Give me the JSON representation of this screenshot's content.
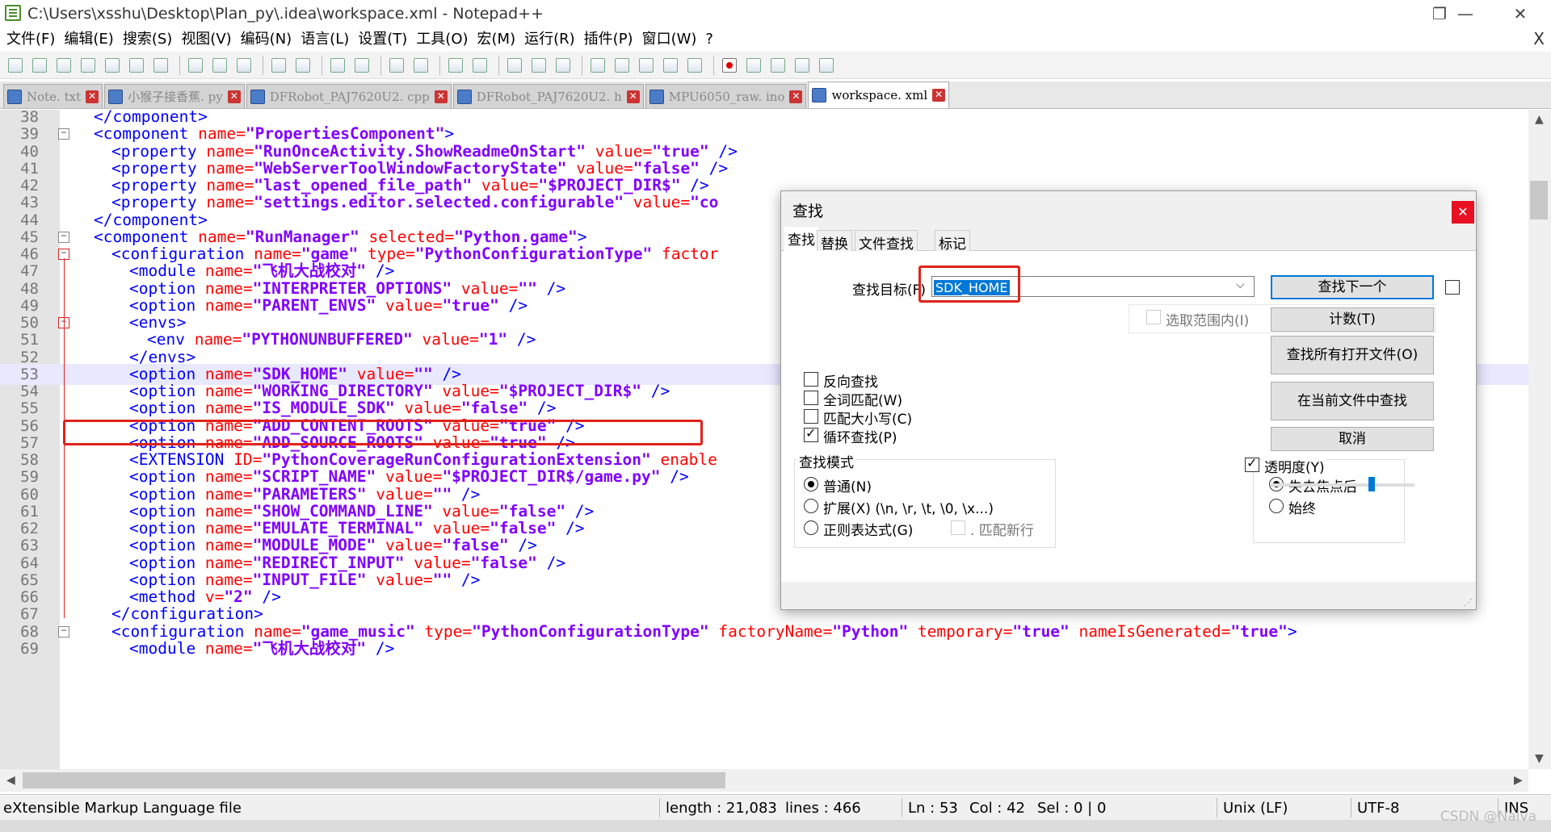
{
  "window": {
    "title": "C:\\Users\\xsshu\\Desktop\\Plan_py\\.idea\\workspace.xml - Notepad++",
    "minimize_glyph": "—",
    "maximize_glyph": "❐",
    "close_glyph": "✕"
  },
  "menubar": {
    "items": [
      "文件(F)",
      "编辑(E)",
      "搜索(S)",
      "视图(V)",
      "编码(N)",
      "语言(L)",
      "设置(T)",
      "工具(O)",
      "宏(M)",
      "运行(R)",
      "插件(P)",
      "窗口(W)",
      "?"
    ],
    "close_glyph": "X"
  },
  "tabs": [
    {
      "label": "Note. txt",
      "active": false
    },
    {
      "label": "小猴子接香蕉. py",
      "active": false
    },
    {
      "label": "DFRobot_PAJ7620U2. cpp",
      "active": false
    },
    {
      "label": "DFRobot_PAJ7620U2. h",
      "active": false
    },
    {
      "label": "MPU6050_raw. ino",
      "active": false
    },
    {
      "label": "workspace. xml",
      "active": true
    }
  ],
  "tab_close_glyph": "✕",
  "editor": {
    "current_line": 53,
    "lines": [
      {
        "n": "38",
        "indent": 1,
        "parts": [
          [
            "t",
            "</component>"
          ]
        ]
      },
      {
        "n": "39",
        "indent": 1,
        "parts": [
          [
            "t",
            "<component "
          ],
          [
            "a",
            "name="
          ],
          [
            "v",
            "\"PropertiesComponent\""
          ],
          [
            "t",
            ">"
          ]
        ]
      },
      {
        "n": "40",
        "indent": 2,
        "parts": [
          [
            "t",
            "<property "
          ],
          [
            "a",
            "name="
          ],
          [
            "v",
            "\"RunOnceActivity.ShowReadmeOnStart\""
          ],
          [
            "a",
            " value="
          ],
          [
            "v",
            "\"true\""
          ],
          [
            "t",
            " />"
          ]
        ]
      },
      {
        "n": "41",
        "indent": 2,
        "parts": [
          [
            "t",
            "<property "
          ],
          [
            "a",
            "name="
          ],
          [
            "v",
            "\"WebServerToolWindowFactoryState\""
          ],
          [
            "a",
            " value="
          ],
          [
            "v",
            "\"false\""
          ],
          [
            "t",
            " />"
          ]
        ]
      },
      {
        "n": "42",
        "indent": 2,
        "parts": [
          [
            "t",
            "<property "
          ],
          [
            "a",
            "name="
          ],
          [
            "v",
            "\"last_opened_file_path\""
          ],
          [
            "a",
            " value="
          ],
          [
            "v",
            "\"$PROJECT_DIR$\""
          ],
          [
            "t",
            " />"
          ]
        ]
      },
      {
        "n": "43",
        "indent": 2,
        "parts": [
          [
            "t",
            "<property "
          ],
          [
            "a",
            "name="
          ],
          [
            "v",
            "\"settings.editor.selected.configurable\""
          ],
          [
            "a",
            " value="
          ],
          [
            "v",
            "\"co"
          ]
        ]
      },
      {
        "n": "44",
        "indent": 1,
        "parts": [
          [
            "t",
            "</component>"
          ]
        ]
      },
      {
        "n": "45",
        "indent": 1,
        "parts": [
          [
            "t",
            "<component "
          ],
          [
            "a",
            "name="
          ],
          [
            "v",
            "\"RunManager\""
          ],
          [
            "a",
            " selected="
          ],
          [
            "v",
            "\"Python.game\""
          ],
          [
            "t",
            ">"
          ]
        ]
      },
      {
        "n": "46",
        "indent": 2,
        "parts": [
          [
            "t",
            "<configuration "
          ],
          [
            "a",
            "name="
          ],
          [
            "v",
            "\"game\""
          ],
          [
            "a",
            " type="
          ],
          [
            "v",
            "\"PythonConfigurationType\""
          ],
          [
            "a",
            " factor"
          ]
        ]
      },
      {
        "n": "47",
        "indent": 3,
        "parts": [
          [
            "t",
            "<module "
          ],
          [
            "a",
            "name="
          ],
          [
            "v",
            "\"飞机大战校对\""
          ],
          [
            "t",
            " />"
          ]
        ]
      },
      {
        "n": "48",
        "indent": 3,
        "parts": [
          [
            "t",
            "<option "
          ],
          [
            "a",
            "name="
          ],
          [
            "v",
            "\"INTERPRETER_OPTIONS\""
          ],
          [
            "a",
            " value="
          ],
          [
            "v",
            "\"\""
          ],
          [
            "t",
            " />"
          ]
        ]
      },
      {
        "n": "49",
        "indent": 3,
        "parts": [
          [
            "t",
            "<option "
          ],
          [
            "a",
            "name="
          ],
          [
            "v",
            "\"PARENT_ENVS\""
          ],
          [
            "a",
            " value="
          ],
          [
            "v",
            "\"true\""
          ],
          [
            "t",
            " />"
          ]
        ]
      },
      {
        "n": "50",
        "indent": 3,
        "parts": [
          [
            "t",
            "<envs>"
          ]
        ]
      },
      {
        "n": "51",
        "indent": 4,
        "parts": [
          [
            "t",
            "<env "
          ],
          [
            "a",
            "name="
          ],
          [
            "v",
            "\"PYTHONUNBUFFERED\""
          ],
          [
            "a",
            " value="
          ],
          [
            "v",
            "\"1\""
          ],
          [
            "t",
            " />"
          ]
        ]
      },
      {
        "n": "52",
        "indent": 3,
        "parts": [
          [
            "t",
            "</envs>"
          ]
        ]
      },
      {
        "n": "53",
        "indent": 3,
        "parts": [
          [
            "t",
            "<option "
          ],
          [
            "a",
            "name="
          ],
          [
            "v",
            "\"SDK_HOME\""
          ],
          [
            "a",
            " value="
          ],
          [
            "v",
            "\"\""
          ],
          [
            "t",
            " />"
          ]
        ]
      },
      {
        "n": "54",
        "indent": 3,
        "parts": [
          [
            "t",
            "<option "
          ],
          [
            "a",
            "name="
          ],
          [
            "v",
            "\"WORKING_DIRECTORY\""
          ],
          [
            "a",
            " value="
          ],
          [
            "v",
            "\"$PROJECT_DIR$\""
          ],
          [
            "t",
            " />"
          ]
        ]
      },
      {
        "n": "55",
        "indent": 3,
        "parts": [
          [
            "t",
            "<option "
          ],
          [
            "a",
            "name="
          ],
          [
            "v",
            "\"IS_MODULE_SDK\""
          ],
          [
            "a",
            " value="
          ],
          [
            "v",
            "\"false\""
          ],
          [
            "t",
            " />"
          ]
        ]
      },
      {
        "n": "56",
        "indent": 3,
        "parts": [
          [
            "t",
            "<option "
          ],
          [
            "a",
            "name="
          ],
          [
            "v",
            "\"ADD_CONTENT_ROOTS\""
          ],
          [
            "a",
            " value="
          ],
          [
            "v",
            "\"true\""
          ],
          [
            "t",
            " />"
          ]
        ]
      },
      {
        "n": "57",
        "indent": 3,
        "parts": [
          [
            "t",
            "<option "
          ],
          [
            "a",
            "name="
          ],
          [
            "v",
            "\"ADD_SOURCE_ROOTS\""
          ],
          [
            "a",
            " value="
          ],
          [
            "v",
            "\"true\""
          ],
          [
            "t",
            " />"
          ]
        ]
      },
      {
        "n": "58",
        "indent": 3,
        "parts": [
          [
            "t",
            "<EXTENSION "
          ],
          [
            "a",
            "ID="
          ],
          [
            "v",
            "\"PythonCoverageRunConfigurationExtension\""
          ],
          [
            "a",
            " enable"
          ]
        ]
      },
      {
        "n": "59",
        "indent": 3,
        "parts": [
          [
            "t",
            "<option "
          ],
          [
            "a",
            "name="
          ],
          [
            "v",
            "\"SCRIPT_NAME\""
          ],
          [
            "a",
            " value="
          ],
          [
            "v",
            "\"$PROJECT_DIR$/game.py\""
          ],
          [
            "t",
            " />"
          ]
        ]
      },
      {
        "n": "60",
        "indent": 3,
        "parts": [
          [
            "t",
            "<option "
          ],
          [
            "a",
            "name="
          ],
          [
            "v",
            "\"PARAMETERS\""
          ],
          [
            "a",
            " value="
          ],
          [
            "v",
            "\"\""
          ],
          [
            "t",
            " />"
          ]
        ]
      },
      {
        "n": "61",
        "indent": 3,
        "parts": [
          [
            "t",
            "<option "
          ],
          [
            "a",
            "name="
          ],
          [
            "v",
            "\"SHOW_COMMAND_LINE\""
          ],
          [
            "a",
            " value="
          ],
          [
            "v",
            "\"false\""
          ],
          [
            "t",
            " />"
          ]
        ]
      },
      {
        "n": "62",
        "indent": 3,
        "parts": [
          [
            "t",
            "<option "
          ],
          [
            "a",
            "name="
          ],
          [
            "v",
            "\"EMULATE_TERMINAL\""
          ],
          [
            "a",
            " value="
          ],
          [
            "v",
            "\"false\""
          ],
          [
            "t",
            " />"
          ]
        ]
      },
      {
        "n": "63",
        "indent": 3,
        "parts": [
          [
            "t",
            "<option "
          ],
          [
            "a",
            "name="
          ],
          [
            "v",
            "\"MODULE_MODE\""
          ],
          [
            "a",
            " value="
          ],
          [
            "v",
            "\"false\""
          ],
          [
            "t",
            " />"
          ]
        ]
      },
      {
        "n": "64",
        "indent": 3,
        "parts": [
          [
            "t",
            "<option "
          ],
          [
            "a",
            "name="
          ],
          [
            "v",
            "\"REDIRECT_INPUT\""
          ],
          [
            "a",
            " value="
          ],
          [
            "v",
            "\"false\""
          ],
          [
            "t",
            " />"
          ]
        ]
      },
      {
        "n": "65",
        "indent": 3,
        "parts": [
          [
            "t",
            "<option "
          ],
          [
            "a",
            "name="
          ],
          [
            "v",
            "\"INPUT_FILE\""
          ],
          [
            "a",
            " value="
          ],
          [
            "v",
            "\"\""
          ],
          [
            "t",
            " />"
          ]
        ]
      },
      {
        "n": "66",
        "indent": 3,
        "parts": [
          [
            "t",
            "<method "
          ],
          [
            "a",
            "v="
          ],
          [
            "v",
            "\"2\""
          ],
          [
            "t",
            " />"
          ]
        ]
      },
      {
        "n": "67",
        "indent": 2,
        "parts": [
          [
            "t",
            "</configuration>"
          ]
        ]
      },
      {
        "n": "68",
        "indent": 2,
        "parts": [
          [
            "t",
            "<configuration "
          ],
          [
            "a",
            "name="
          ],
          [
            "v",
            "\"game_music\""
          ],
          [
            "a",
            " type="
          ],
          [
            "v",
            "\"PythonConfigurationType\""
          ],
          [
            "a",
            " factoryName="
          ],
          [
            "v",
            "\"Python\""
          ],
          [
            "a",
            " temporary="
          ],
          [
            "v",
            "\"true\""
          ],
          [
            "a",
            " nameIsGenerated="
          ],
          [
            "v",
            "\"true\""
          ],
          [
            "t",
            ">"
          ]
        ]
      },
      {
        "n": "69",
        "indent": 3,
        "parts": [
          [
            "t",
            "<module "
          ],
          [
            "a",
            "name="
          ],
          [
            "v",
            "\"飞机大战校对\""
          ],
          [
            "t",
            " />"
          ]
        ]
      }
    ],
    "fold_markers": {
      "39": "−",
      "45": "−",
      "46": "−",
      "50": "−",
      "68": "−"
    }
  },
  "statusbar": {
    "file_type": "eXtensible Markup Language file",
    "length": "length : 21,083",
    "lines": "lines : 466",
    "ln": "Ln : 53",
    "col": "Col : 42",
    "sel": "Sel : 0 | 0",
    "eol": "Unix (LF)",
    "encoding": "UTF-8",
    "mode": "INS"
  },
  "watermark": "CSDN @Naiva",
  "find_dialog": {
    "title": "查找",
    "close_glyph": "✕",
    "tabs": [
      "查找",
      "替换",
      "文件查找",
      "标记"
    ],
    "find_label": "查找目标(F) :",
    "find_value": "SDK_HOME",
    "combo_arrow": "⌵",
    "in_selection_label": "选取范围内(I)",
    "buttons": {
      "find_next": "查找下一个",
      "count": "计数(T)",
      "find_all_open": "查找所有打开文件(O)",
      "find_all_current": "在当前文件中查找",
      "cancel": "取消"
    },
    "options": [
      {
        "label": "反向查找",
        "checked": false
      },
      {
        "label": "全词匹配(W)",
        "checked": false
      },
      {
        "label": "匹配大小写(C)",
        "checked": false
      },
      {
        "label": "循环查找(P)",
        "checked": true
      }
    ],
    "search_mode": {
      "legend": "查找模式",
      "normal": "普通(N)",
      "extended": "扩展(X) (\\n, \\r, \\t, \\0, \\x...)",
      "regex": "正则表达式(G)",
      "dot_newline": ". 匹配新行",
      "selected": "normal"
    },
    "transparency": {
      "label": "透明度(Y)",
      "checked": true,
      "on_lose_focus": "失去焦点后",
      "always": "始终",
      "selected": "on_lose_focus",
      "level": 0.7
    }
  },
  "colors": {
    "tag": "#0000ff",
    "attr": "#ff0000",
    "value": "#8000ff",
    "highlight_box": "#e0221a",
    "current_line": "#e8e8ff"
  }
}
